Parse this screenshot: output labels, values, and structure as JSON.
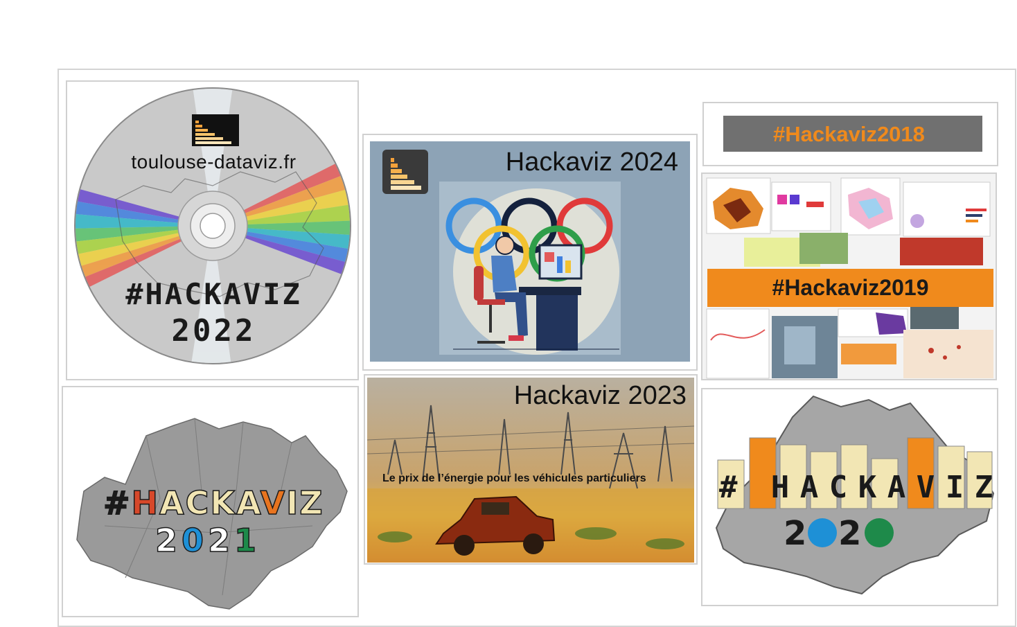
{
  "tiles": {
    "h2022": {
      "site": "toulouse-dataviz.fr",
      "hashtag": "#HACKAVIZ",
      "year": "2022"
    },
    "h2024": {
      "title": "Hackaviz 2024"
    },
    "h2018": {
      "label": "#Hackaviz2018"
    },
    "h2019": {
      "label": "#Hackaviz2019"
    },
    "h2021": {
      "hash": "#",
      "letters": [
        "H",
        "A",
        "C",
        "K",
        "A",
        "V",
        "I",
        "Z"
      ],
      "letter_colors": [
        "#d7482a",
        "#f2e6b4",
        "#f2e6b4",
        "#f2e6b4",
        "#f2e6b4",
        "#e8741f",
        "#f2e6b4",
        "#f2e6b4"
      ],
      "digits": [
        "2",
        "0",
        "2",
        "1"
      ],
      "digit_colors": [
        "#ffffff",
        "#1e90d6",
        "#ffffff",
        "#1e8a4a"
      ]
    },
    "h2023": {
      "title": "Hackaviz 2023",
      "subtitle": "Le prix de l’énergie pour les véhicules particuliers"
    },
    "h2020": {
      "hash": "#",
      "letters": [
        "H",
        "A",
        "C",
        "K",
        "A",
        "V",
        "I",
        "Z"
      ],
      "digit_a": "2",
      "digit_b": "2"
    }
  },
  "colors": {
    "orange": "#f08a1c",
    "dark_gray_bar": "#707070",
    "steel_blue": "#8da3b6"
  },
  "icons": [
    "bar-chart-logo-icon",
    "olympic-rings-icon",
    "cd-disc-icon",
    "occitanie-map-icon"
  ]
}
